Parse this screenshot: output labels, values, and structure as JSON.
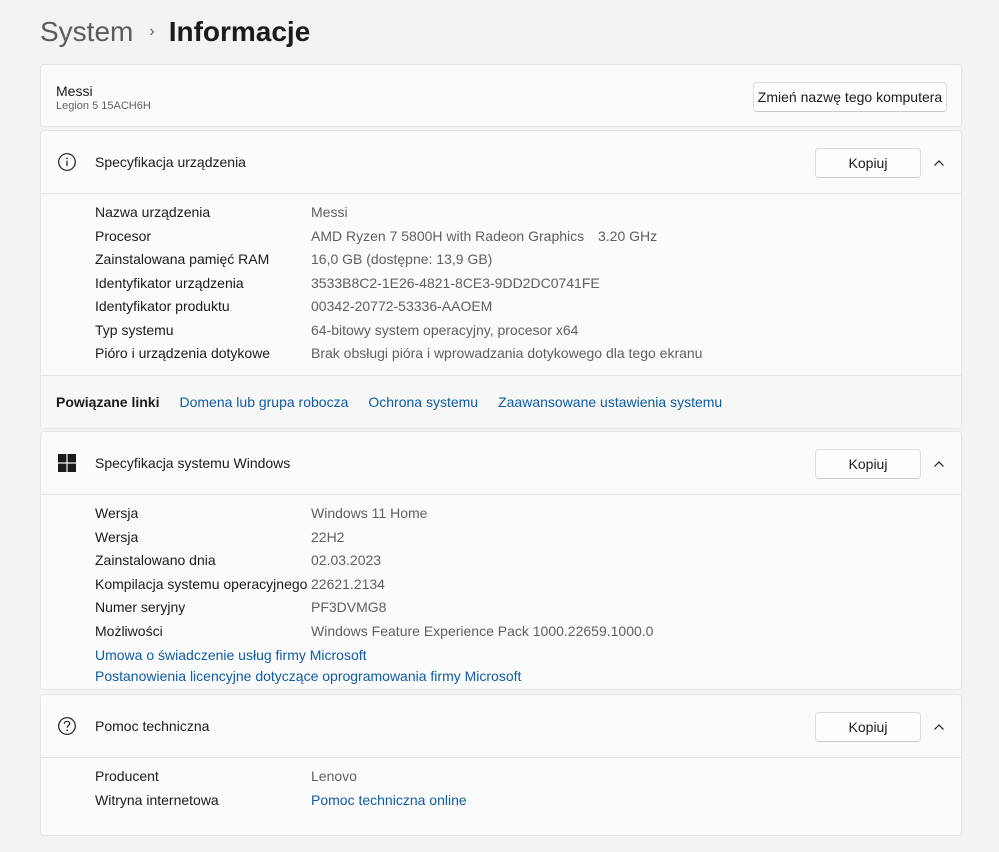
{
  "breadcrumb": {
    "parent": "System",
    "separator": "›",
    "current": "Informacje"
  },
  "computer": {
    "name": "Messi",
    "model": "Legion 5 15ACH6H",
    "rename_label": "Zmień nazwę tego komputera"
  },
  "device_specs": {
    "title": "Specyfikacja urządzenia",
    "copy_label": "Kopiuj",
    "rows": [
      {
        "label": "Nazwa urządzenia",
        "value": "Messi"
      },
      {
        "label": "Procesor",
        "value": "AMD Ryzen 7 5800H with Radeon Graphics",
        "extra": "3.20 GHz"
      },
      {
        "label": "Zainstalowana pamięć RAM",
        "value": "16,0 GB (dostępne: 13,9 GB)"
      },
      {
        "label": "Identyfikator urządzenia",
        "value": "3533B8C2-1E26-4821-8CE3-9DD2DC0741FE"
      },
      {
        "label": "Identyfikator produktu",
        "value": "00342-20772-53336-AAOEM"
      },
      {
        "label": "Typ systemu",
        "value": "64-bitowy system operacyjny, procesor x64"
      },
      {
        "label": "Pióro i urządzenia dotykowe",
        "value": "Brak obsługi pióra i wprowadzania dotykowego dla tego ekranu"
      }
    ]
  },
  "related_links": {
    "label": "Powiązane linki",
    "links": [
      "Domena lub grupa robocza",
      "Ochrona systemu",
      "Zaawansowane ustawienia systemu"
    ]
  },
  "windows_specs": {
    "title": "Specyfikacja systemu Windows",
    "copy_label": "Kopiuj",
    "rows": [
      {
        "label": "Wersja",
        "value": "Windows 11 Home"
      },
      {
        "label": "Wersja",
        "value": "22H2"
      },
      {
        "label": "Zainstalowano dnia",
        "value": "02.03.2023"
      },
      {
        "label": "Kompilacja systemu operacyjnego",
        "value": "22621.2134"
      },
      {
        "label": "Numer seryjny",
        "value": "PF3DVMG8"
      },
      {
        "label": "Możliwości",
        "value": "Windows Feature Experience Pack 1000.22659.1000.0"
      }
    ],
    "links": [
      "Umowa o świadczenie usług firmy Microsoft",
      "Postanowienia licencyjne dotyczące oprogramowania firmy Microsoft"
    ]
  },
  "support": {
    "title": "Pomoc techniczna",
    "copy_label": "Kopiuj",
    "manufacturer_label": "Producent",
    "manufacturer_value": "Lenovo",
    "website_label": "Witryna internetowa",
    "website_link": "Pomoc techniczna online"
  },
  "colors": {
    "link": "#0f5ba7",
    "background": "#f3f3f3",
    "card": "#fbfbfb"
  },
  "icons": [
    "info-icon",
    "windows-logo-icon",
    "help-icon",
    "chevron-up-icon",
    "chevron-right-icon"
  ]
}
